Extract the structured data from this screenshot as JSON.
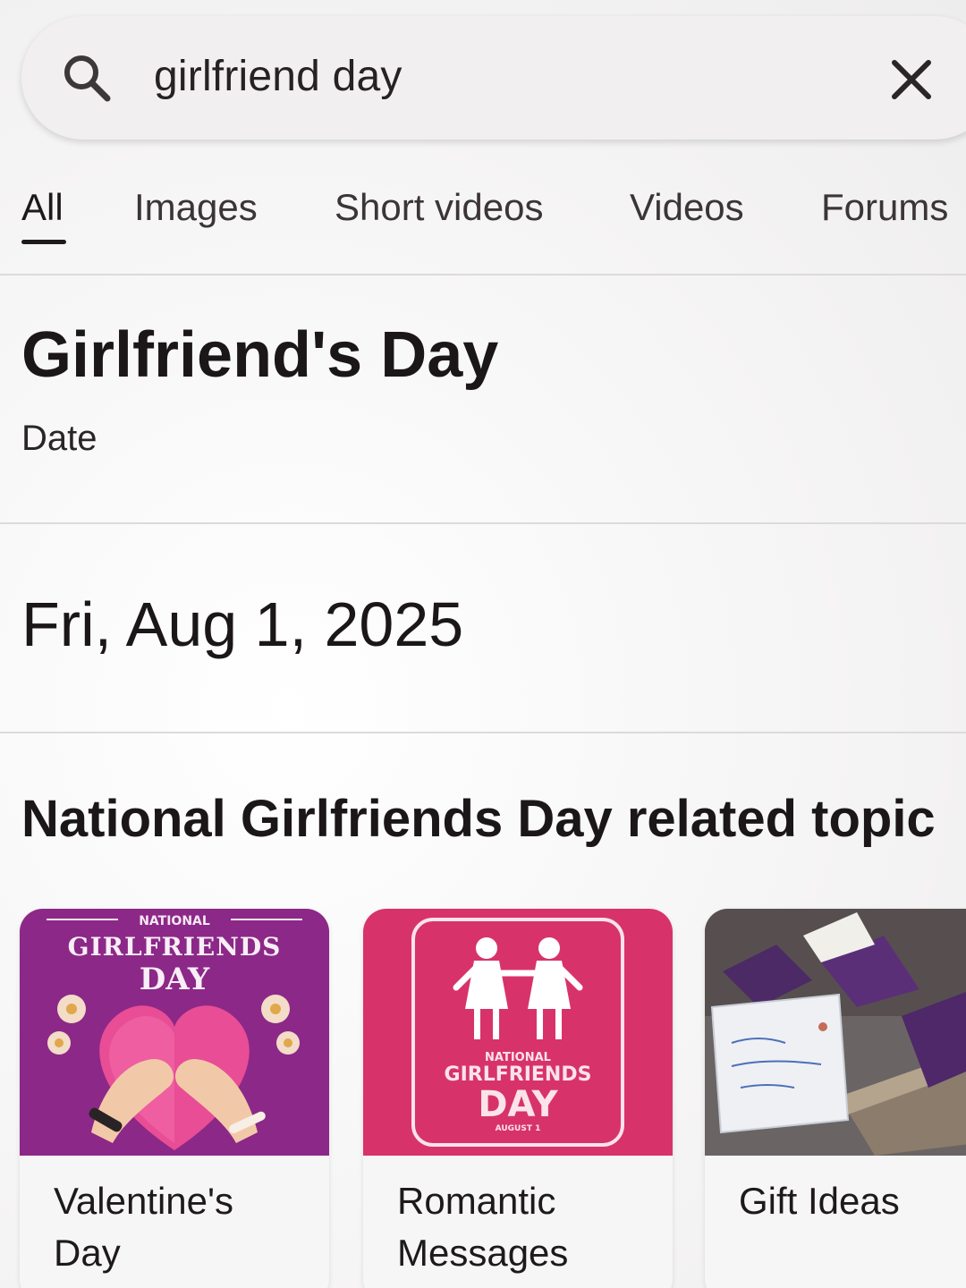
{
  "search": {
    "query": "girlfriend day"
  },
  "tabs": [
    {
      "label": "All",
      "active": true
    },
    {
      "label": "Images"
    },
    {
      "label": "Short videos"
    },
    {
      "label": "Videos"
    },
    {
      "label": "Forums"
    }
  ],
  "event": {
    "title": "Girlfriend's Day",
    "subtitle": "Date",
    "date": "Fri, Aug 1, 2025"
  },
  "related": {
    "heading": "National Girlfriends Day related topic",
    "cards": [
      {
        "label": "Valentine's Day",
        "image_text": [
          "NATIONAL",
          "GIRLFRIENDS",
          "DAY"
        ],
        "icon": "pinky-promise-heart-image"
      },
      {
        "label": "Romantic Messages",
        "image_text": [
          "NATIONAL",
          "GIRLFRIENDS",
          "DAY",
          "AUGUST 1"
        ],
        "icon": "two-girls-holding-hands-image"
      },
      {
        "label": "Gift Ideas",
        "icon": "gift-box-with-card-image"
      }
    ]
  },
  "colors": {
    "card1_bg": "#9b2f8f",
    "card2_bg": "#d7336a",
    "card3_bg": "#6a6564",
    "accent_text": "#1e1a1c"
  }
}
